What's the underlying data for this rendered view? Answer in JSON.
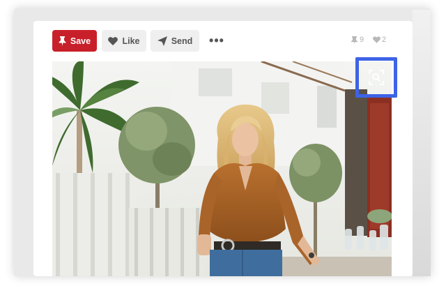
{
  "toolbar": {
    "save_label": "Save",
    "like_label": "Like",
    "send_label": "Send",
    "more_label": "•••",
    "repin_count": "9",
    "like_count": "2"
  },
  "icons": {
    "save": "pushpin-icon",
    "like": "heart-icon",
    "send": "paper-plane-icon",
    "repins": "pin-icon",
    "likes": "heart-icon",
    "visual_search": "visual-search-icon"
  },
  "colors": {
    "save_button": "#c8202a",
    "secondary_button": "#efefef",
    "visual_search_highlight": "#3d63e6"
  }
}
